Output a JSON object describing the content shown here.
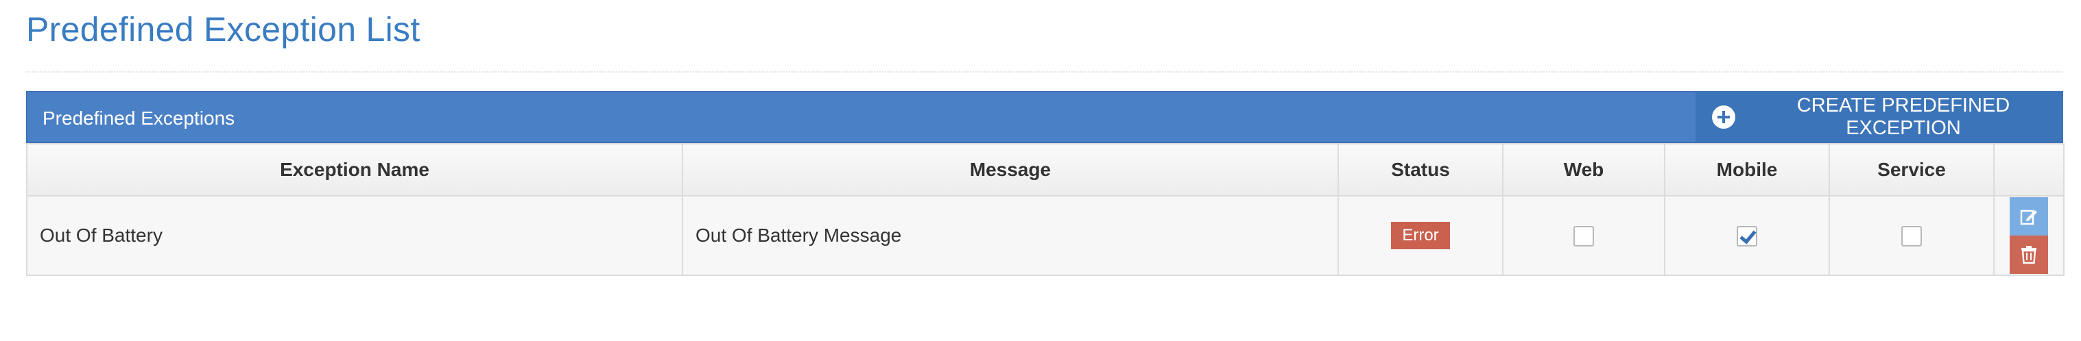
{
  "page": {
    "title": "Predefined Exception List"
  },
  "panel": {
    "title": "Predefined Exceptions",
    "create_button_label": "CREATE PREDEFINED EXCEPTION"
  },
  "table": {
    "columns": [
      "Exception Name",
      "Message",
      "Status",
      "Web",
      "Mobile",
      "Service",
      ""
    ],
    "rows": [
      {
        "name": "Out Of Battery",
        "message": "Out Of Battery Message",
        "status": "Error",
        "web": false,
        "mobile": true,
        "service": false
      }
    ]
  },
  "icons": {
    "create": "plus-circle-icon",
    "edit": "edit-icon",
    "delete": "trash-icon"
  },
  "colors": {
    "title": "#3a7cc2",
    "panel_header": "#4a80c6",
    "create_button": "#3c74b9",
    "status_error": "#c9614e",
    "edit_button": "#7aaee3",
    "delete_button": "#cc6655"
  }
}
